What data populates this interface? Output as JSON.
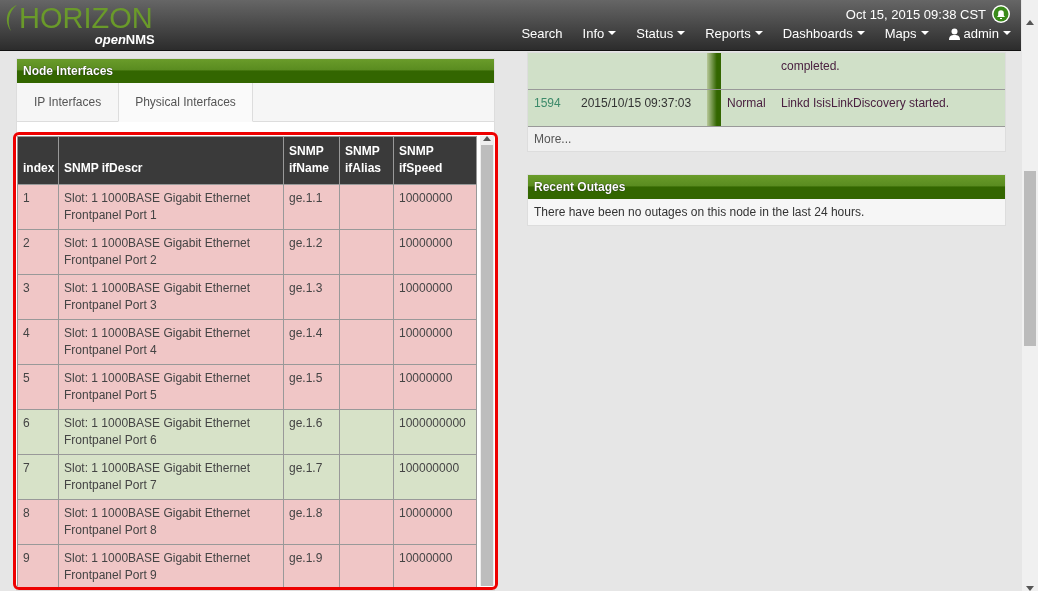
{
  "logo": {
    "title": "HORIZON",
    "sub_italic": "open",
    "sub_bold": "NMS"
  },
  "datetime": "Oct 15, 2015 09:38 CST",
  "nav": [
    {
      "label": "Search",
      "kind": "link"
    },
    {
      "label": "Info",
      "kind": "dropdown"
    },
    {
      "label": "Status",
      "kind": "dropdown"
    },
    {
      "label": "Reports",
      "kind": "dropdown"
    },
    {
      "label": "Dashboards",
      "kind": "dropdown"
    },
    {
      "label": "Maps",
      "kind": "dropdown"
    },
    {
      "label": "admin",
      "kind": "user"
    }
  ],
  "node_interfaces": {
    "title": "Node Interfaces",
    "tabs": [
      {
        "label": "IP Interfaces",
        "selected": false
      },
      {
        "label": "Physical Interfaces",
        "selected": true
      }
    ],
    "columns": [
      "index",
      "SNMP ifDescr",
      "SNMP ifName",
      "SNMP ifAlias",
      "SNMP ifSpeed"
    ],
    "rows": [
      {
        "index": "1",
        "descr": "Slot: 1 1000BASE Gigabit Ethernet Frontpanel Port 1",
        "name": "ge.1.1",
        "speed": "10000000",
        "color": "#f0c6c6"
      },
      {
        "index": "2",
        "descr": "Slot: 1 1000BASE Gigabit Ethernet Frontpanel Port 2",
        "name": "ge.1.2",
        "speed": "10000000",
        "color": "#f0c6c6"
      },
      {
        "index": "3",
        "descr": "Slot: 1 1000BASE Gigabit Ethernet Frontpanel Port 3",
        "name": "ge.1.3",
        "speed": "10000000",
        "color": "#f0c6c6"
      },
      {
        "index": "4",
        "descr": "Slot: 1 1000BASE Gigabit Ethernet Frontpanel Port 4",
        "name": "ge.1.4",
        "speed": "10000000",
        "color": "#f0c6c6"
      },
      {
        "index": "5",
        "descr": "Slot: 1 1000BASE Gigabit Ethernet Frontpanel Port 5",
        "name": "ge.1.5",
        "speed": "10000000",
        "color": "#f0c6c6"
      },
      {
        "index": "6",
        "descr": "Slot: 1 1000BASE Gigabit Ethernet Frontpanel Port 6",
        "name": "ge.1.6",
        "speed": "1000000000",
        "color": "#d7e2c8"
      },
      {
        "index": "7",
        "descr": "Slot: 1 1000BASE Gigabit Ethernet Frontpanel Port 7",
        "name": "ge.1.7",
        "speed": "100000000",
        "color": "#d7e2c8"
      },
      {
        "index": "8",
        "descr": "Slot: 1 1000BASE Gigabit Ethernet Frontpanel Port 8",
        "name": "ge.1.8",
        "speed": "10000000",
        "color": "#f0c6c6"
      },
      {
        "index": "9",
        "descr": "Slot: 1 1000BASE Gigabit Ethernet Frontpanel Port 9",
        "name": "ge.1.9",
        "speed": "10000000",
        "color": "#f0c6c6"
      }
    ]
  },
  "events": {
    "rows": [
      {
        "message": "completed."
      },
      {
        "id": "1594",
        "time": "2015/10/15 09:37:03",
        "severity": "Normal",
        "message": "Linkd IsisLinkDiscovery started."
      }
    ],
    "more": "More..."
  },
  "recent_outages": {
    "title": "Recent Outages",
    "message": "There have been no outages on this node in the last 24 hours."
  }
}
